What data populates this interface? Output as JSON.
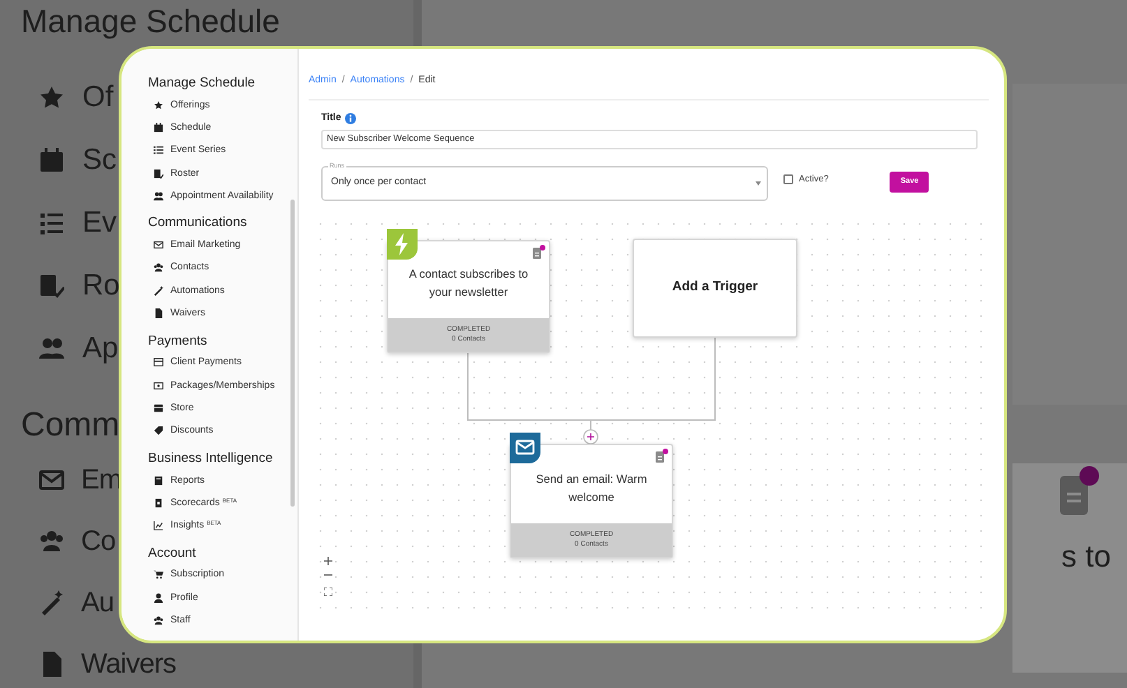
{
  "background": {
    "heading": "Manage Schedule",
    "items": [
      {
        "label": "Of"
      },
      {
        "label": "Sc"
      },
      {
        "label": "Ev"
      },
      {
        "label": "Ro"
      },
      {
        "label": "Ap"
      }
    ],
    "heading_2": "Comm",
    "items_2": [
      {
        "label": "Em"
      },
      {
        "label": "Co"
      },
      {
        "label": "Au"
      },
      {
        "label": "Waivers"
      }
    ],
    "node_text": "s to"
  },
  "sidebar": {
    "sections": [
      {
        "title": "Manage Schedule",
        "items": [
          {
            "label": "Offerings"
          },
          {
            "label": "Schedule"
          },
          {
            "label": "Event Series"
          },
          {
            "label": "Roster"
          },
          {
            "label": "Appointment Availability"
          }
        ]
      },
      {
        "title": "Communications",
        "items": [
          {
            "label": "Email Marketing"
          },
          {
            "label": "Contacts"
          },
          {
            "label": "Automations"
          },
          {
            "label": "Waivers"
          }
        ]
      },
      {
        "title": "Payments",
        "items": [
          {
            "label": "Client Payments"
          },
          {
            "label": "Packages/Memberships"
          },
          {
            "label": "Store"
          },
          {
            "label": "Discounts"
          }
        ]
      },
      {
        "title": "Business Intelligence",
        "items": [
          {
            "label": "Reports"
          },
          {
            "label": "Scorecards $^{BETA}$"
          },
          {
            "label": "Insights $^{BETA}$"
          }
        ]
      },
      {
        "title": "Account",
        "items": [
          {
            "label": "Subscription"
          },
          {
            "label": "Profile"
          },
          {
            "label": "Staff"
          }
        ]
      }
    ]
  },
  "breadcrumb": [
    {
      "kind": "link",
      "label": "Admin"
    },
    {
      "kind": "separator",
      "label": "/"
    },
    {
      "kind": "link",
      "label": "Automations"
    },
    {
      "kind": "separator",
      "label": "/"
    },
    {
      "kind": "current",
      "label": "Edit"
    }
  ],
  "form": {
    "title_label": "Title",
    "title_value": "New Subscriber Welcome Sequence",
    "runs_label": "Runs",
    "runs_value": "Only once per contact",
    "active": {
      "label": "Active?",
      "checked": false
    },
    "save": "Save"
  },
  "nodes": [
    {
      "kind": "trigger",
      "text": "A contact subscribes to your newsletter",
      "status": "COMPLETED",
      "count": "0 Contacts"
    },
    {
      "kind": "empty",
      "text": "Add a Trigger"
    },
    {
      "kind": "email",
      "text": "Send an email: Warm welcome",
      "status": "COMPLETED",
      "count": "0 Contacts"
    }
  ]
}
